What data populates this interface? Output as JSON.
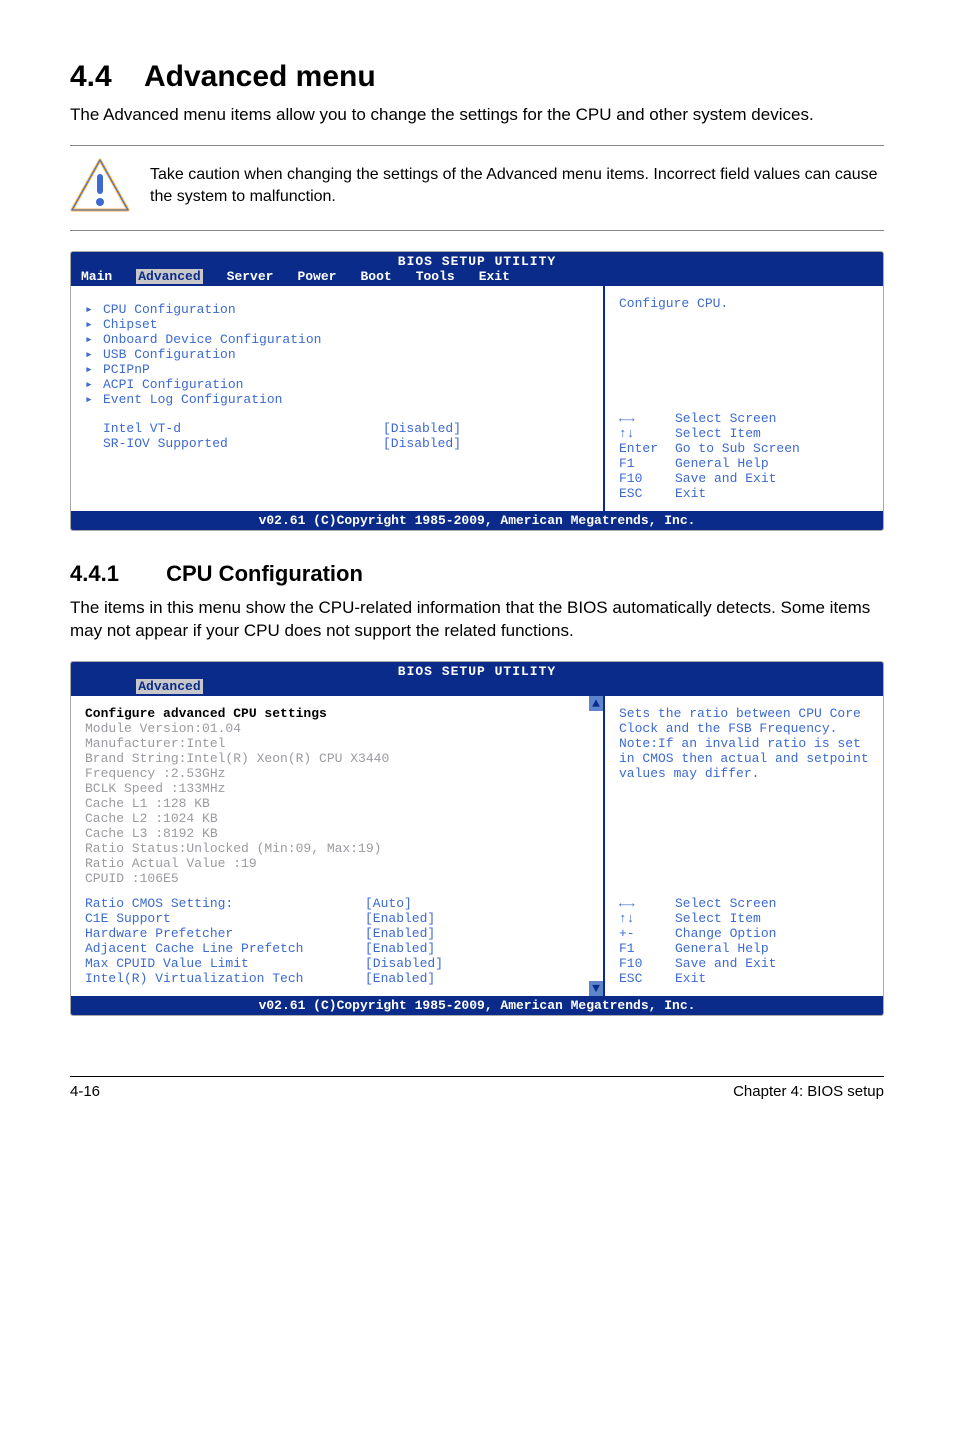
{
  "section": {
    "number": "4.4",
    "title": "Advanced menu",
    "intro": "The Advanced menu items allow you to change the settings for the CPU and other system devices."
  },
  "caution": {
    "text": "Take caution when changing the settings of the Advanced menu items. Incorrect field values can cause the system to malfunction."
  },
  "bios1": {
    "title": "BIOS SETUP UTILITY",
    "tabs": [
      "Main",
      "Advanced",
      "Server",
      "Power",
      "Boot",
      "Tools",
      "Exit"
    ],
    "active_tab": "Advanced",
    "menu_items": [
      "CPU Configuration",
      "Chipset",
      "Onboard Device Configuration",
      "USB Configuration",
      "PCIPnP",
      "ACPI Configuration",
      "Event Log Configuration"
    ],
    "settings": [
      {
        "label": "Intel VT-d",
        "value": "[Disabled]"
      },
      {
        "label": "SR-IOV Supported",
        "value": "[Disabled]"
      }
    ],
    "right_top": "Configure CPU.",
    "keys": [
      {
        "k": "←→",
        "d": "Select Screen"
      },
      {
        "k": "↑↓",
        "d": "Select Item"
      },
      {
        "k": "Enter",
        "d": "Go to Sub Screen"
      },
      {
        "k": "F1",
        "d": "General Help"
      },
      {
        "k": "F10",
        "d": "Save and Exit"
      },
      {
        "k": "ESC",
        "d": "Exit"
      }
    ],
    "footer": "v02.61 (C)Copyright 1985-2009, American Megatrends, Inc."
  },
  "subsection": {
    "number": "4.4.1",
    "title": "CPU Configuration",
    "intro": "The items in this menu show the CPU-related information that the BIOS automatically detects. Some items may not appear if your CPU does not support the related functions."
  },
  "bios2": {
    "title": "BIOS SETUP UTILITY",
    "active_tab": "Advanced",
    "heading": "Configure advanced CPU settings",
    "module": "Module Version:01.04",
    "info": [
      "Manufacturer:Intel",
      "Brand String:Intel(R) Xeon(R)  CPU           X3440",
      "Frequency    :2.53GHz",
      "BCLK Speed   :133MHz",
      "Cache L1     :128  KB",
      "Cache L2     :1024 KB",
      "Cache L3     :8192 KB",
      "Ratio Status:Unlocked (Min:09, Max:19)",
      "Ratio Actual Value  :19",
      "CPUID        :106E5"
    ],
    "settings": [
      {
        "label": "Ratio CMOS Setting:",
        "value": "[Auto]"
      },
      {
        "label": "C1E Support",
        "value": "[Enabled]"
      },
      {
        "label": "Hardware Prefetcher",
        "value": "[Enabled]"
      },
      {
        "label": "Adjacent Cache Line Prefetch",
        "value": "[Enabled]"
      },
      {
        "label": "Max CPUID Value Limit",
        "value": "[Disabled]"
      },
      {
        "label": "Intel(R) Virtualization Tech",
        "value": "[Enabled]"
      }
    ],
    "right_top": "Sets the ratio between CPU Core Clock and the FSB Frequency.\nNote:If an invalid ratio is set in CMOS then actual and setpoint values may differ.",
    "keys": [
      {
        "k": "←→",
        "d": "Select Screen"
      },
      {
        "k": "↑↓",
        "d": "Select Item"
      },
      {
        "k": "+-",
        "d": "Change Option"
      },
      {
        "k": "F1",
        "d": "General Help"
      },
      {
        "k": "F10",
        "d": "Save and Exit"
      },
      {
        "k": "ESC",
        "d": "Exit"
      }
    ],
    "footer": "v02.61 (C)Copyright 1985-2009, American Megatrends, Inc."
  },
  "page_footer": {
    "left": "4-16",
    "right": "Chapter 4: BIOS setup"
  }
}
